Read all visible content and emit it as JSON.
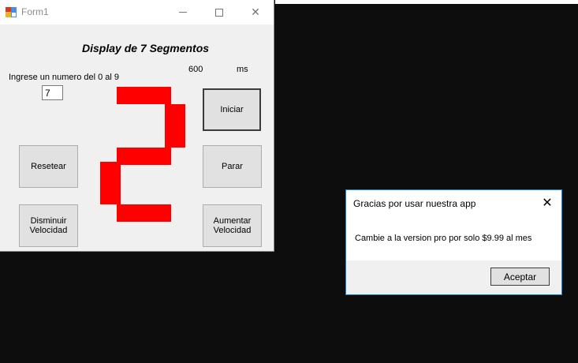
{
  "form": {
    "title": "Form1",
    "heading": "Display de 7 Segmentos",
    "instruction": "Ingrese un numero del 0 al 9",
    "input_value": "7",
    "speed_value": "600",
    "speed_unit": "ms",
    "display_digit": "2",
    "segment_color": "#ff0000",
    "buttons": {
      "start": "Iniciar",
      "reset": "Resetear",
      "stop": "Parar",
      "decrease": "Disminuir Velocidad",
      "increase": "Aumentar Velocidad"
    },
    "caption_icons": [
      "minimize-icon",
      "maximize-icon",
      "close-icon"
    ]
  },
  "message_box": {
    "title": "Gracias por usar nuestra app",
    "text": "Cambie a la version pro por solo $9.99 al mes",
    "ok_label": "Aceptar",
    "accent": "#1883d7"
  }
}
